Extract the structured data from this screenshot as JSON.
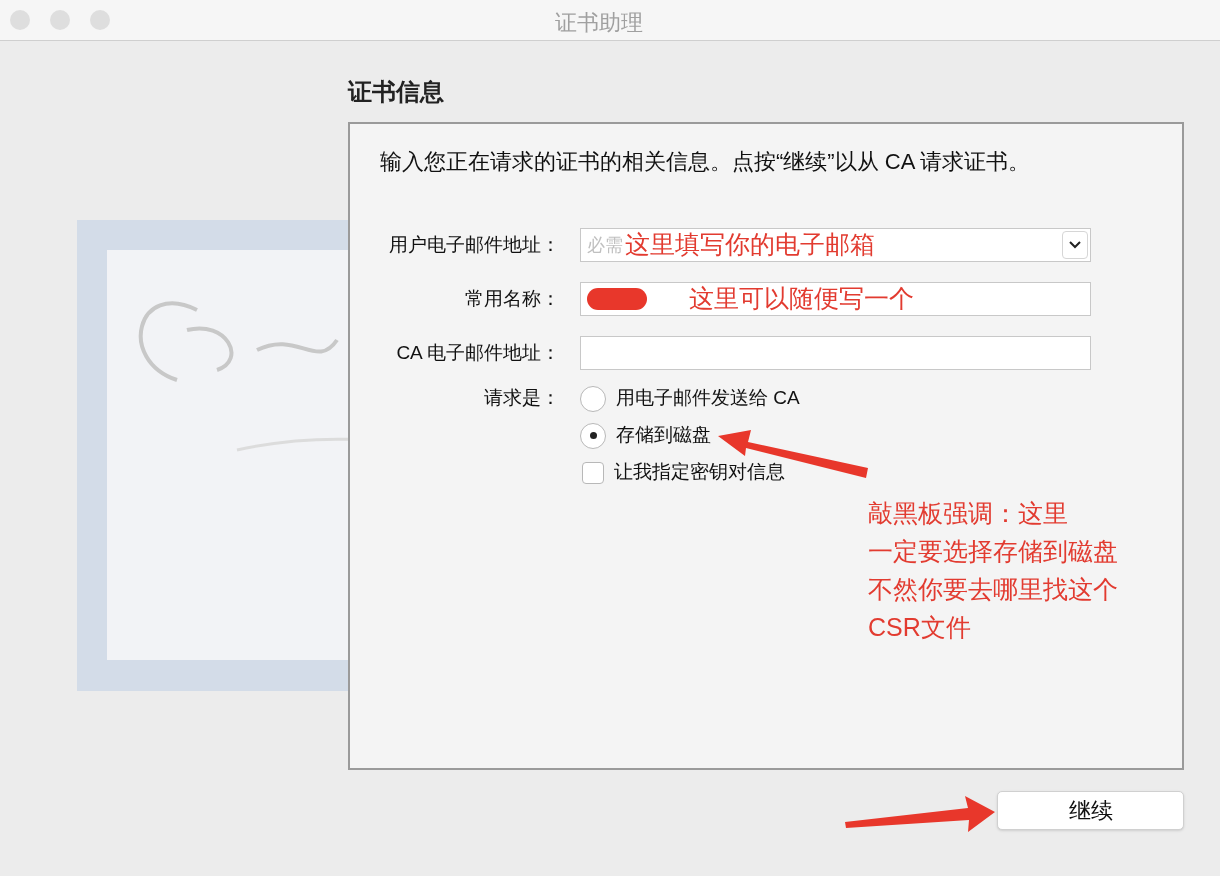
{
  "window": {
    "title": "证书助理"
  },
  "section_title": "证书信息",
  "intro": "输入您正在请求的证书的相关信息。点按“继续”以从 CA 请求证书。",
  "fields": [
    {
      "kind": "combo",
      "label": "用户电子邮件地址：",
      "placeholder": "必需",
      "note": "这里填写你的电子邮箱"
    },
    {
      "kind": "text",
      "label": "常用名称：",
      "note": "这里可以随便写一个",
      "redacted": true
    },
    {
      "kind": "text",
      "label": "CA 电子邮件地址："
    }
  ],
  "request": {
    "label": "请求是：",
    "options": [
      {
        "kind": "radio",
        "label": "用电子邮件发送给 CA",
        "selected": false
      },
      {
        "kind": "radio",
        "label": "存储到磁盘",
        "selected": true
      },
      {
        "kind": "checkbox",
        "label": "让我指定密钥对信息",
        "checked": false
      }
    ]
  },
  "annotation": [
    "敲黑板强调：这里",
    "一定要选择存储到磁盘",
    "不然你要去哪里找这个",
    "CSR文件"
  ],
  "buttons": [
    "继续"
  ]
}
